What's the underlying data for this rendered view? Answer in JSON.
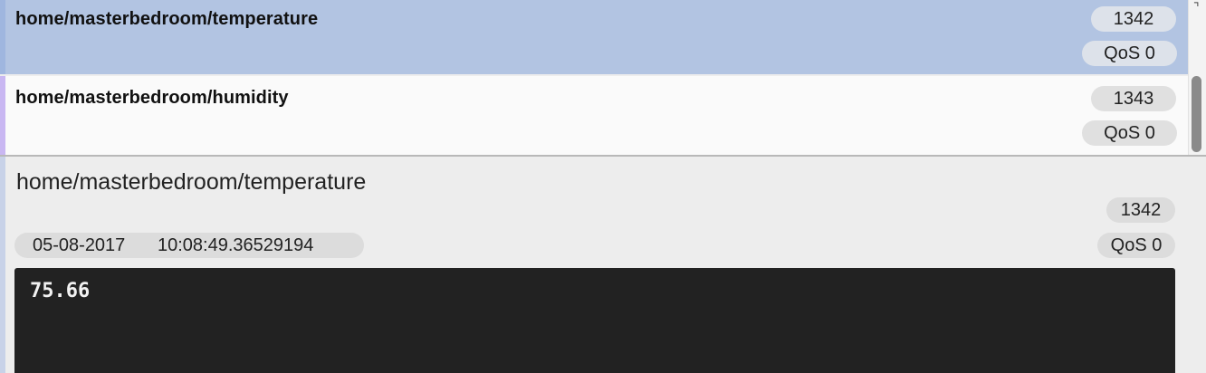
{
  "colors": {
    "selected_row": "#b2c4e2",
    "row_background": "#fafafa",
    "accent_row_1": "#9fb6df",
    "accent_row_2": "#c9b7f2",
    "payload_background": "#222222",
    "payload_text": "#f2f2f2"
  },
  "topics": [
    {
      "name": "home/masterbedroom/temperature",
      "count": "1342",
      "qos": "QoS 0",
      "selected": true
    },
    {
      "name": "home/masterbedroom/humidity",
      "count": "1343",
      "qos": "QoS 0",
      "selected": false
    }
  ],
  "detail": {
    "topic": "home/masterbedroom/temperature",
    "count": "1342",
    "qos": "QoS 0",
    "date": "05-08-2017",
    "time": "10:08:49.36529194",
    "payload": "75.66"
  },
  "icons": {
    "corner": "resize-corner-icon"
  }
}
